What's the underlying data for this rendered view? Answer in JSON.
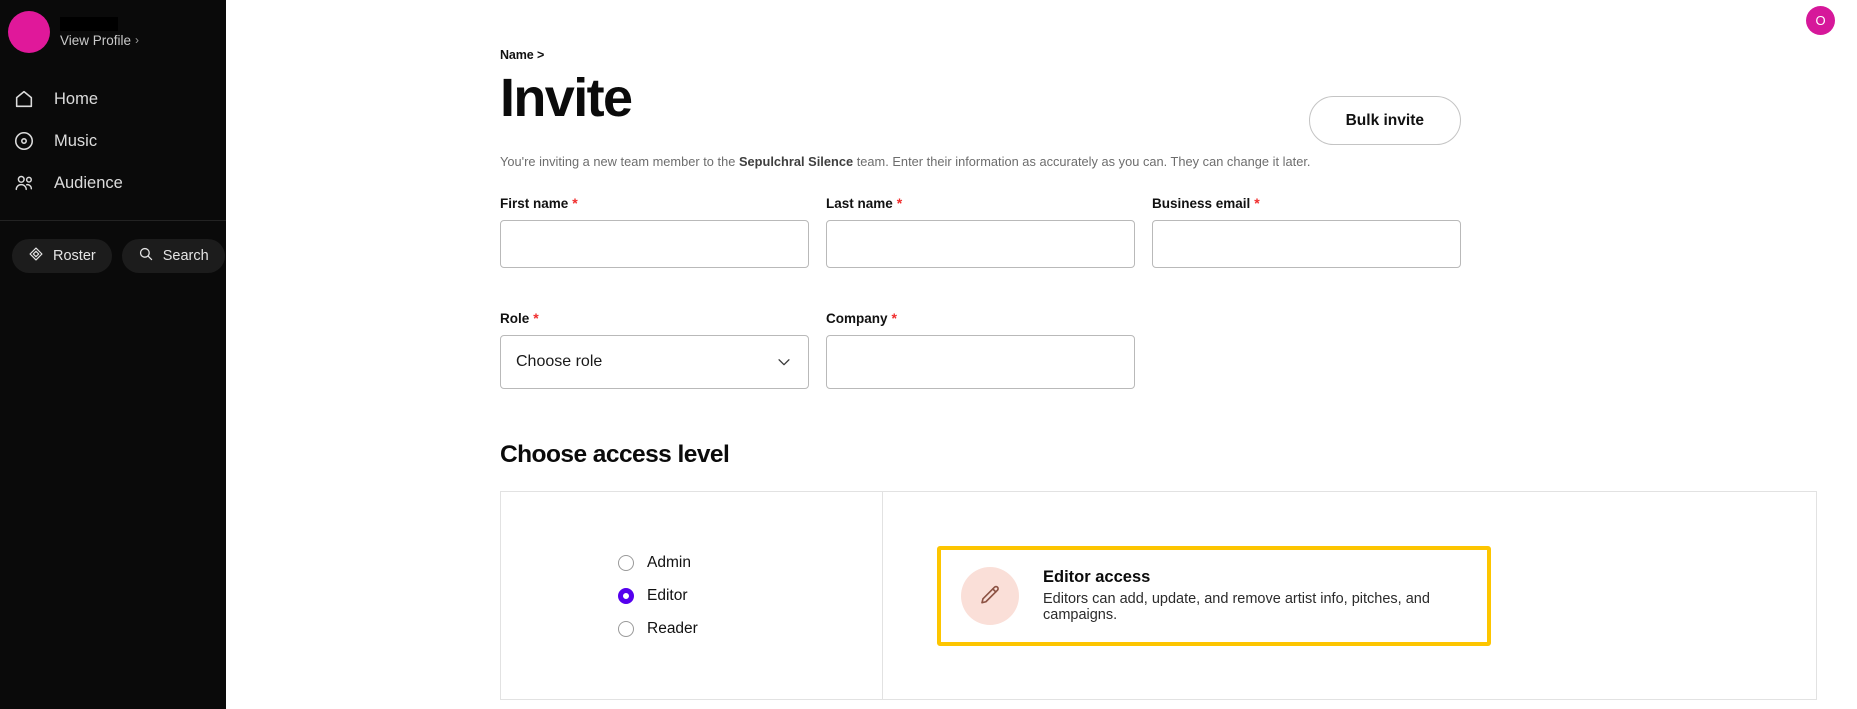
{
  "sidebar": {
    "profile": {
      "view_profile_label": "View Profile",
      "chevron": "chevron-right-icon",
      "avatar_color": "#e0189a"
    },
    "nav_items": [
      {
        "label": "Home",
        "icon": "home-icon"
      },
      {
        "label": "Music",
        "icon": "disc-icon"
      },
      {
        "label": "Audience",
        "icon": "people-icon"
      }
    ],
    "pills": [
      {
        "label": "Roster",
        "icon": "roster-diamond-icon"
      },
      {
        "label": "Search",
        "icon": "search-icon"
      }
    ]
  },
  "topbar": {
    "avatar_initial": "O",
    "avatar_color": "#d6189a"
  },
  "header": {
    "breadcrumb": "Name >",
    "title": "Invite",
    "bulk_invite_label": "Bulk invite",
    "subtitle_part1": "You're inviting a new team member to the ",
    "subtitle_team": "Sepulchral Silence",
    "subtitle_part2": " team. Enter their information as accurately as you can. They can change it later."
  },
  "form": {
    "required_marker": "*",
    "fields": [
      {
        "label": "First name",
        "value": "",
        "placeholder": ""
      },
      {
        "label": "Last name",
        "value": "",
        "placeholder": ""
      },
      {
        "label": "Business email",
        "value": "",
        "placeholder": ""
      }
    ],
    "role": {
      "label": "Role",
      "selected": "Choose role",
      "options": [
        "Choose role"
      ]
    },
    "company": {
      "label": "Company",
      "value": "",
      "placeholder": ""
    }
  },
  "access": {
    "section_title": "Choose access level",
    "options": [
      {
        "label": "Admin",
        "selected": false
      },
      {
        "label": "Editor",
        "selected": true
      },
      {
        "label": "Reader",
        "selected": false
      }
    ],
    "detail": {
      "icon": "pencil-icon",
      "title": "Editor access",
      "description": "Editors can add, update, and remove artist info, pitches, and campaigns.",
      "highlight_color": "#fdc500",
      "icon_bg_color": "#fadfd8"
    }
  },
  "colors": {
    "accent_purple": "#5500ee",
    "brand_pink": "#e0189a",
    "required_red": "#f02d2d",
    "sidebar_bg": "#0a0a0a"
  }
}
